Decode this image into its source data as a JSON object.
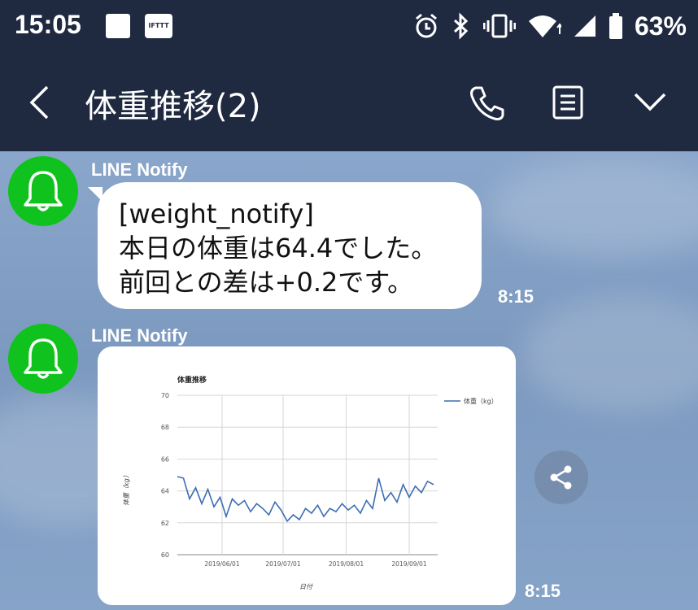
{
  "status_bar": {
    "time": "15:05",
    "notification_icons": [
      "square-icon",
      "ifttt-icon"
    ],
    "ifttt_label": "IFTTT",
    "system_icons": [
      "alarm-icon",
      "bluetooth-icon",
      "vibrate-icon",
      "wifi-icon",
      "signal-icon",
      "battery-icon"
    ],
    "battery_percent": "63%"
  },
  "header": {
    "title": "体重推移(2)",
    "back_icon": "chevron-left-icon",
    "actions": [
      "phone-icon",
      "notes-icon",
      "chevron-down-icon"
    ]
  },
  "messages": [
    {
      "sender": "LINE Notify",
      "avatar_icon": "bell-icon",
      "lines": [
        "[weight_notify]",
        "本日の体重は64.4でした。",
        "前回との差は+0.2です。"
      ],
      "time": "8:15"
    },
    {
      "sender": "LINE Notify",
      "avatar_icon": "bell-icon",
      "type": "image",
      "time": "8:15",
      "share_icon": "share-icon"
    }
  ],
  "chart_data": {
    "type": "line",
    "title": "体重推移",
    "xlabel": "日付",
    "ylabel": "体重（kg）",
    "ylim": [
      60,
      70
    ],
    "yticks": [
      60,
      62,
      64,
      66,
      68,
      70
    ],
    "xticks": [
      "2019/06/01",
      "2019/07/01",
      "2019/08/01",
      "2019/09/01"
    ],
    "xlim": [
      "2019-05-10",
      "2019-09-15"
    ],
    "grid": true,
    "legend_position": "right",
    "series": [
      {
        "name": "体重（kg）",
        "color": "#3b6db3",
        "x": [
          "2019-05-10",
          "2019-05-13",
          "2019-05-16",
          "2019-05-19",
          "2019-05-22",
          "2019-05-25",
          "2019-05-28",
          "2019-05-31",
          "2019-06-03",
          "2019-06-06",
          "2019-06-09",
          "2019-06-12",
          "2019-06-15",
          "2019-06-18",
          "2019-06-21",
          "2019-06-24",
          "2019-06-27",
          "2019-06-30",
          "2019-07-03",
          "2019-07-06",
          "2019-07-09",
          "2019-07-12",
          "2019-07-15",
          "2019-07-18",
          "2019-07-21",
          "2019-07-24",
          "2019-07-27",
          "2019-07-30",
          "2019-08-02",
          "2019-08-05",
          "2019-08-08",
          "2019-08-11",
          "2019-08-14",
          "2019-08-17",
          "2019-08-20",
          "2019-08-23",
          "2019-08-26",
          "2019-08-29",
          "2019-09-01",
          "2019-09-04",
          "2019-09-07",
          "2019-09-10",
          "2019-09-13"
        ],
        "y": [
          64.9,
          64.8,
          63.5,
          64.2,
          63.2,
          64.1,
          63.0,
          63.6,
          62.4,
          63.5,
          63.1,
          63.4,
          62.7,
          63.2,
          62.9,
          62.5,
          63.3,
          62.8,
          62.1,
          62.5,
          62.2,
          62.9,
          62.6,
          63.1,
          62.4,
          62.9,
          62.7,
          63.2,
          62.8,
          63.1,
          62.6,
          63.4,
          62.9,
          64.8,
          63.4,
          63.9,
          63.3,
          64.4,
          63.6,
          64.3,
          63.9,
          64.6,
          64.4
        ]
      }
    ]
  }
}
